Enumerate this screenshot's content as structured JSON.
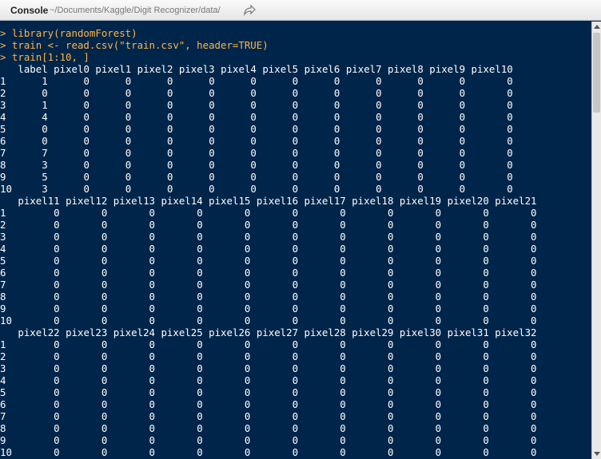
{
  "panel": {
    "title": "Console",
    "path": "~/Documents/Kaggle/Digit Recognizer/data/"
  },
  "console": {
    "commands": [
      "> library(randomForest)",
      "> train <- read.csv(\"train.csv\", header=TRUE)",
      "> train[1:10, ]"
    ],
    "row_names": [
      "1",
      "2",
      "3",
      "4",
      "5",
      "6",
      "7",
      "8",
      "9",
      "10"
    ],
    "blocks": [
      {
        "columns": [
          "label",
          "pixel0",
          "pixel1",
          "pixel2",
          "pixel3",
          "pixel4",
          "pixel5",
          "pixel6",
          "pixel7",
          "pixel8",
          "pixel9",
          "pixel10"
        ],
        "rows": [
          [
            "1",
            "0",
            "0",
            "0",
            "0",
            "0",
            "0",
            "0",
            "0",
            "0",
            "0",
            "0"
          ],
          [
            "0",
            "0",
            "0",
            "0",
            "0",
            "0",
            "0",
            "0",
            "0",
            "0",
            "0",
            "0"
          ],
          [
            "1",
            "0",
            "0",
            "0",
            "0",
            "0",
            "0",
            "0",
            "0",
            "0",
            "0",
            "0"
          ],
          [
            "4",
            "0",
            "0",
            "0",
            "0",
            "0",
            "0",
            "0",
            "0",
            "0",
            "0",
            "0"
          ],
          [
            "0",
            "0",
            "0",
            "0",
            "0",
            "0",
            "0",
            "0",
            "0",
            "0",
            "0",
            "0"
          ],
          [
            "0",
            "0",
            "0",
            "0",
            "0",
            "0",
            "0",
            "0",
            "0",
            "0",
            "0",
            "0"
          ],
          [
            "7",
            "0",
            "0",
            "0",
            "0",
            "0",
            "0",
            "0",
            "0",
            "0",
            "0",
            "0"
          ],
          [
            "3",
            "0",
            "0",
            "0",
            "0",
            "0",
            "0",
            "0",
            "0",
            "0",
            "0",
            "0"
          ],
          [
            "5",
            "0",
            "0",
            "0",
            "0",
            "0",
            "0",
            "0",
            "0",
            "0",
            "0",
            "0"
          ],
          [
            "3",
            "0",
            "0",
            "0",
            "0",
            "0",
            "0",
            "0",
            "0",
            "0",
            "0",
            "0"
          ]
        ]
      },
      {
        "columns": [
          "pixel11",
          "pixel12",
          "pixel13",
          "pixel14",
          "pixel15",
          "pixel16",
          "pixel17",
          "pixel18",
          "pixel19",
          "pixel20",
          "pixel21"
        ],
        "rows": [
          [
            "0",
            "0",
            "0",
            "0",
            "0",
            "0",
            "0",
            "0",
            "0",
            "0",
            "0"
          ],
          [
            "0",
            "0",
            "0",
            "0",
            "0",
            "0",
            "0",
            "0",
            "0",
            "0",
            "0"
          ],
          [
            "0",
            "0",
            "0",
            "0",
            "0",
            "0",
            "0",
            "0",
            "0",
            "0",
            "0"
          ],
          [
            "0",
            "0",
            "0",
            "0",
            "0",
            "0",
            "0",
            "0",
            "0",
            "0",
            "0"
          ],
          [
            "0",
            "0",
            "0",
            "0",
            "0",
            "0",
            "0",
            "0",
            "0",
            "0",
            "0"
          ],
          [
            "0",
            "0",
            "0",
            "0",
            "0",
            "0",
            "0",
            "0",
            "0",
            "0",
            "0"
          ],
          [
            "0",
            "0",
            "0",
            "0",
            "0",
            "0",
            "0",
            "0",
            "0",
            "0",
            "0"
          ],
          [
            "0",
            "0",
            "0",
            "0",
            "0",
            "0",
            "0",
            "0",
            "0",
            "0",
            "0"
          ],
          [
            "0",
            "0",
            "0",
            "0",
            "0",
            "0",
            "0",
            "0",
            "0",
            "0",
            "0"
          ],
          [
            "0",
            "0",
            "0",
            "0",
            "0",
            "0",
            "0",
            "0",
            "0",
            "0",
            "0"
          ]
        ]
      },
      {
        "columns": [
          "pixel22",
          "pixel23",
          "pixel24",
          "pixel25",
          "pixel26",
          "pixel27",
          "pixel28",
          "pixel29",
          "pixel30",
          "pixel31",
          "pixel32"
        ],
        "rows": [
          [
            "0",
            "0",
            "0",
            "0",
            "0",
            "0",
            "0",
            "0",
            "0",
            "0",
            "0"
          ],
          [
            "0",
            "0",
            "0",
            "0",
            "0",
            "0",
            "0",
            "0",
            "0",
            "0",
            "0"
          ],
          [
            "0",
            "0",
            "0",
            "0",
            "0",
            "0",
            "0",
            "0",
            "0",
            "0",
            "0"
          ],
          [
            "0",
            "0",
            "0",
            "0",
            "0",
            "0",
            "0",
            "0",
            "0",
            "0",
            "0"
          ],
          [
            "0",
            "0",
            "0",
            "0",
            "0",
            "0",
            "0",
            "0",
            "0",
            "0",
            "0"
          ],
          [
            "0",
            "0",
            "0",
            "0",
            "0",
            "0",
            "0",
            "0",
            "0",
            "0",
            "0"
          ],
          [
            "0",
            "0",
            "0",
            "0",
            "0",
            "0",
            "0",
            "0",
            "0",
            "0",
            "0"
          ],
          [
            "0",
            "0",
            "0",
            "0",
            "0",
            "0",
            "0",
            "0",
            "0",
            "0",
            "0"
          ],
          [
            "0",
            "0",
            "0",
            "0",
            "0",
            "0",
            "0",
            "0",
            "0",
            "0",
            "0"
          ],
          [
            "0",
            "0",
            "0",
            "0",
            "0",
            "0",
            "0",
            "0",
            "0",
            "0",
            "0"
          ]
        ]
      }
    ]
  },
  "colors": {
    "background": "#00254a",
    "command_text": "#ffb547",
    "output_text": "#ffffff"
  },
  "icons": {
    "goto_directory": "arrow-right-icon"
  }
}
